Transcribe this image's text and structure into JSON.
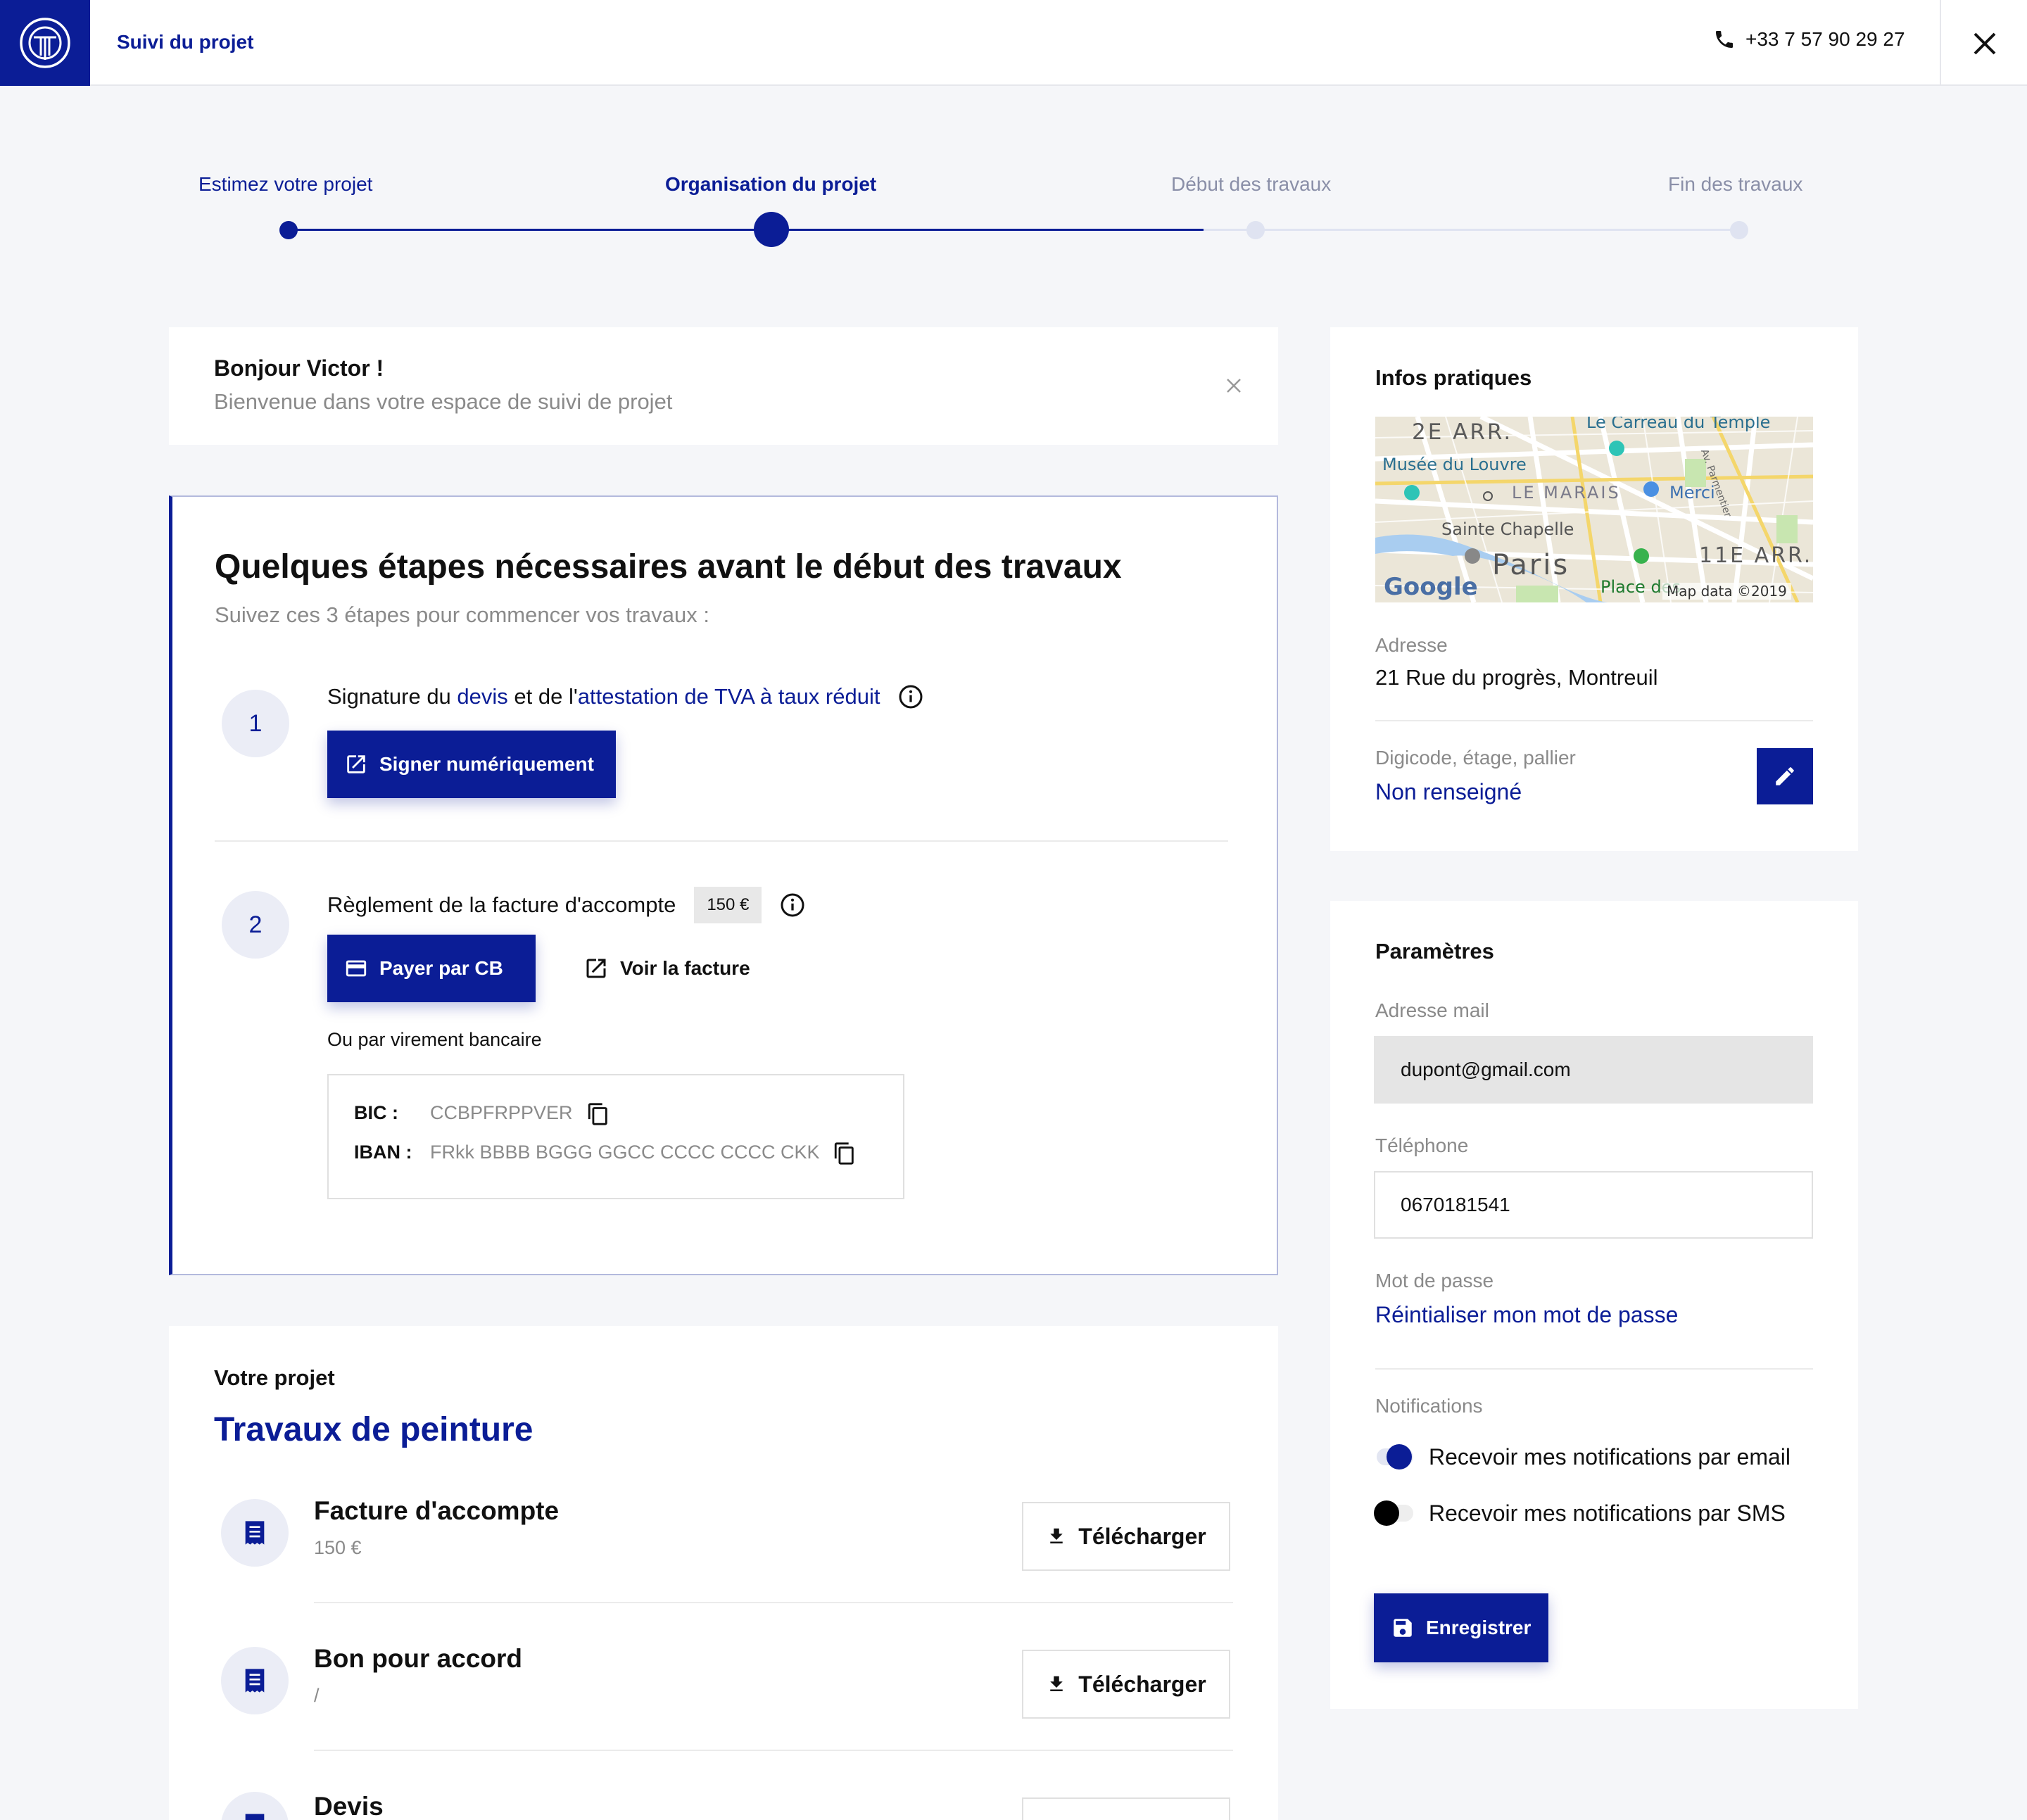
{
  "header": {
    "title": "Suivi du projet",
    "phone": "+33 7 57 90 29 27"
  },
  "stepper": {
    "steps": [
      {
        "label": "Estimez votre projet",
        "state": "done"
      },
      {
        "label": "Organisation du projet",
        "state": "current"
      },
      {
        "label": "Début des travaux",
        "state": "todo"
      },
      {
        "label": "Fin des travaux",
        "state": "todo"
      }
    ]
  },
  "welcome": {
    "title": "Bonjour Victor !",
    "subtitle": "Bienvenue dans votre espace de suivi de projet"
  },
  "steps_card": {
    "title": "Quelques étapes nécessaires avant le début des travaux",
    "subtitle": "Suivez ces 3 étapes pour commencer vos travaux :",
    "step1": {
      "number": "1",
      "text_prefix": "Signature du ",
      "link_devis": "devis",
      "text_mid": " et de l'",
      "link_attestation": "attestation de TVA à taux réduit",
      "button": "Signer numériquement"
    },
    "step2": {
      "number": "2",
      "text": "Règlement de la facture d'accompte",
      "amount": "150 €",
      "pay_button": "Payer par CB",
      "invoice_link": "Voir la facture",
      "alt_text": "Ou par virement bancaire",
      "bic_label": "BIC :",
      "bic_value": "CCBPFRPPVER",
      "iban_label": "IBAN :",
      "iban_value": "FRkk BBBB BGGG GGCC CCCC CCCC CKK"
    }
  },
  "project": {
    "label": "Votre projet",
    "name": "Travaux de peinture",
    "documents": [
      {
        "title": "Facture d'accompte",
        "sub": "150 €",
        "button": "Télécharger"
      },
      {
        "title": "Bon pour accord",
        "sub": "/",
        "button": "Télécharger"
      },
      {
        "title": "Devis",
        "sub": "",
        "button": ""
      }
    ]
  },
  "infos": {
    "title": "Infos pratiques",
    "map": {
      "labels": [
        "2E ARR.",
        "Le Carreau du Temple",
        "Musée du Louvre",
        "LE MARAIS",
        "Merci",
        "Av. Parmentier",
        "Sainte Chapelle",
        "Paris",
        "11E ARR.",
        "Place des",
        "Map data ©2019"
      ],
      "logo": "Google"
    },
    "address_label": "Adresse",
    "address": "21 Rue du progrès, Montreuil",
    "digicode_label": "Digicode, étage, pallier",
    "digicode_value": "Non renseigné"
  },
  "params": {
    "title": "Paramètres",
    "email_label": "Adresse mail",
    "email": "dupont@gmail.com",
    "phone_label": "Téléphone",
    "phone": "0670181541",
    "password_label": "Mot de passe",
    "password_link": "Réintialiser mon mot de passe",
    "notif_label": "Notifications",
    "notif_email": "Recevoir mes notifications par email",
    "notif_sms": "Recevoir mes notifications par SMS",
    "save": "Enregistrer"
  },
  "colors": {
    "primary": "#0b1d96",
    "background": "#f5f6f9",
    "step_inactive": "#dfe3f1"
  }
}
